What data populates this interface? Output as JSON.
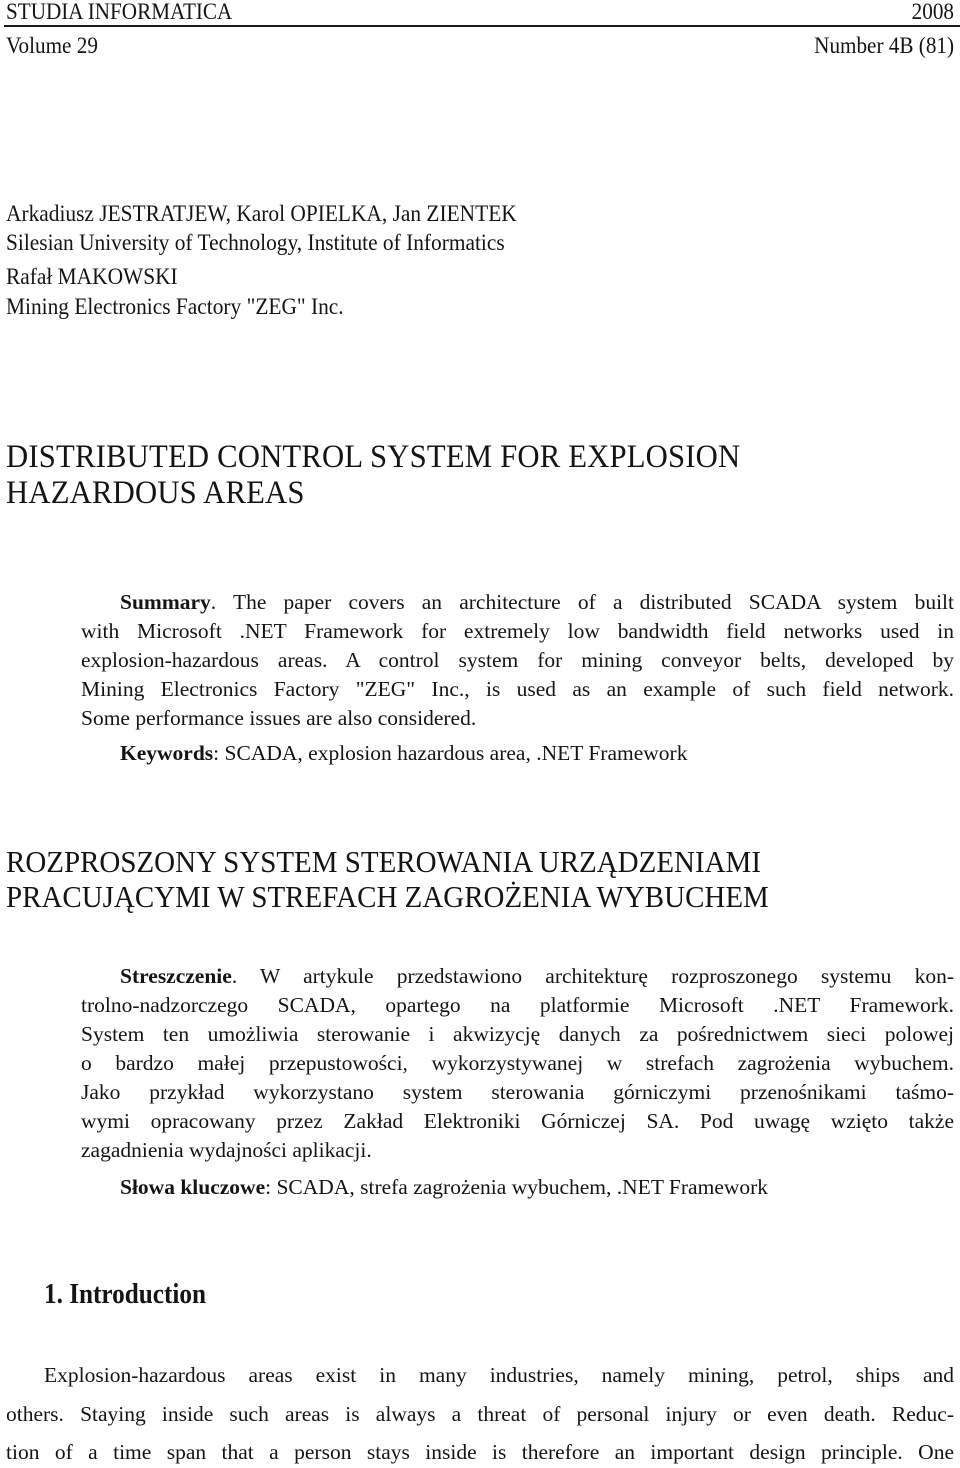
{
  "header": {
    "journal": "STUDIA INFORMATICA",
    "year": "2008",
    "volume": "Volume 29",
    "number": "Number 4B (81)"
  },
  "authors": [
    {
      "line": "Arkadiusz JESTRATJEW, Karol OPIELKA, Jan ZIENTEK"
    },
    {
      "line": "Silesian University of Technology, Institute of Informatics"
    },
    {
      "line": "Rafał MAKOWSKI"
    },
    {
      "line": "Mining Electronics Factory \"ZEG\" Inc."
    }
  ],
  "title_en": {
    "line1": "DISTRIBUTED CONTROL SYSTEM FOR EXPLOSION",
    "line2": "HAZARDOUS AREAS"
  },
  "summary": {
    "label": "Summary",
    "lines": [
      ". The paper covers an architecture of a distributed SCADA system built",
      "with Microsoft .NET Framework for extremely low bandwidth field networks used in",
      "explosion-hazardous areas. A control system for mining conveyor belts, developed by",
      "Mining Electronics Factory \"ZEG\" Inc., is used as an example of such field network.",
      "Some performance issues are also considered."
    ],
    "keywords_label": "Keywords",
    "keywords_text": ": SCADA, explosion hazardous area, .NET Framework"
  },
  "title_pl": {
    "line1": "ROZPROSZONY SYSTEM STEROWANIA URZĄDZENIAMI",
    "line2": "PRACUJĄCYMI W STREFACH ZAGROŻENIA WYBUCHEM"
  },
  "streszczenie": {
    "label": "Streszczenie",
    "lines": [
      ". W artykule przedstawiono architekturę rozproszonego systemu kon-",
      "trolno-nadzorczego SCADA, opartego na platformie Microsoft .NET Framework.",
      "System ten umożliwia sterowanie i akwizycję danych za pośrednictwem sieci polowej",
      "o bardzo małej przepustowości, wykorzystywanej w strefach zagrożenia wybuchem.",
      "Jako przykład wykorzystano system sterowania górniczymi przenośnikami taśmo-",
      "wymi opracowany przez Zakład Elektroniki Górniczej SA. Pod uwagę wzięto także",
      "zagadnienia wydajności aplikacji."
    ],
    "keywords_label": "Słowa kluczowe",
    "keywords_text": ": SCADA, strefa zagrożenia wybuchem, .NET Framework"
  },
  "section1": {
    "heading": "1. Introduction",
    "lines": [
      "Explosion-hazardous areas exist in many industries, namely mining, petrol, ships and",
      "others. Staying inside such areas is always a threat of personal injury or even death. Reduc-",
      "tion of a time span that a person stays inside is therefore an important design principle. One"
    ]
  }
}
